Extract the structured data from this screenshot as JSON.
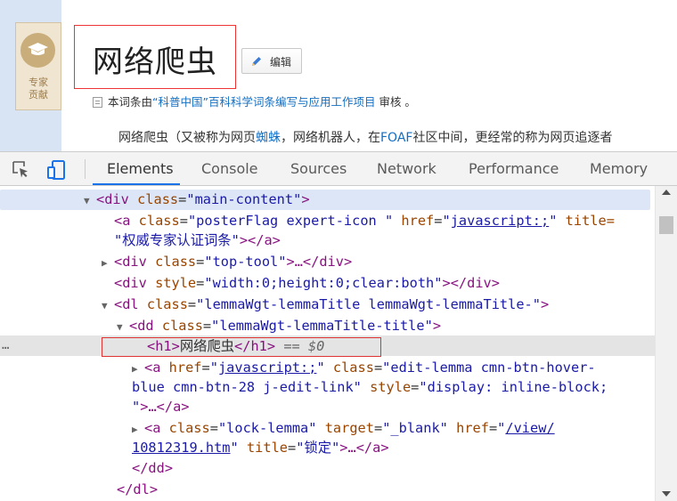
{
  "page": {
    "expert_badge": {
      "label_line1": "专家",
      "label_line2": "贡献"
    },
    "title": "网络爬虫",
    "edit_button": "编辑",
    "source": {
      "prefix": "本词条由",
      "link": "“科普中国”百科科学词条编写与应用工作项目",
      "suffix": " 审核 。"
    },
    "summary": {
      "part1": "网络爬虫（又被称为网页",
      "link1": "蜘蛛",
      "part2": "，网络机器人，在",
      "link2": "FOAF",
      "part3": "社区中间，更经常的称为网页追逐者"
    }
  },
  "devtools": {
    "tabs": [
      "Elements",
      "Console",
      "Sources",
      "Network",
      "Performance",
      "Memory"
    ],
    "active_tab": "Elements",
    "dom": {
      "l1": {
        "tag": "div",
        "attr": "class",
        "val": "main-content"
      },
      "l2": {
        "tag": "a",
        "attr1": "class",
        "val1": "posterFlag expert-icon ",
        "attr2": "href",
        "val2": "javascript:;",
        "attr3": "title=",
        "cont_val": "权威专家认证词条",
        "close": "</a>"
      },
      "l3": {
        "tag": "div",
        "attr": "class",
        "val": "top-tool",
        "rest": "…</div>"
      },
      "l4": {
        "tag": "div",
        "attr": "style",
        "val": "width:0;height:0;clear:both",
        "rest": "</div>"
      },
      "l5": {
        "tag": "dl",
        "attr": "class",
        "val": "lemmaWgt-lemmaTitle lemmaWgt-lemmaTitle-"
      },
      "l6": {
        "tag": "dd",
        "attr": "class",
        "val": "lemmaWgt-lemmaTitle-title"
      },
      "l7": {
        "open": "<h1>",
        "text": "网络爬虫",
        "close": "</h1>",
        "eq": " == ",
        "sel": "$0"
      },
      "l8": {
        "tag": "a",
        "attr1": "href",
        "val1": "javascript:;",
        "attr2": "class",
        "val2_start": "edit-lemma cmn-btn-hover-",
        "val2_cont": "blue cmn-btn-28 j-edit-link",
        "attr3": "style",
        "val3": "display: inline-block;",
        "rest": "…</a>"
      },
      "l9": {
        "tag": "a",
        "attr1": "class",
        "val1": "lock-lemma",
        "attr2": "target",
        "val2": "_blank",
        "attr3": "href",
        "val3_start": "/view/",
        "val3_cont": "10812319.htm",
        "attr4": "title",
        "val4": "锁定",
        "rest": "…</a>"
      },
      "l10": {
        "text": "</dd>"
      },
      "l11": {
        "text": "</dl>"
      }
    },
    "gutter_dots": "…"
  }
}
